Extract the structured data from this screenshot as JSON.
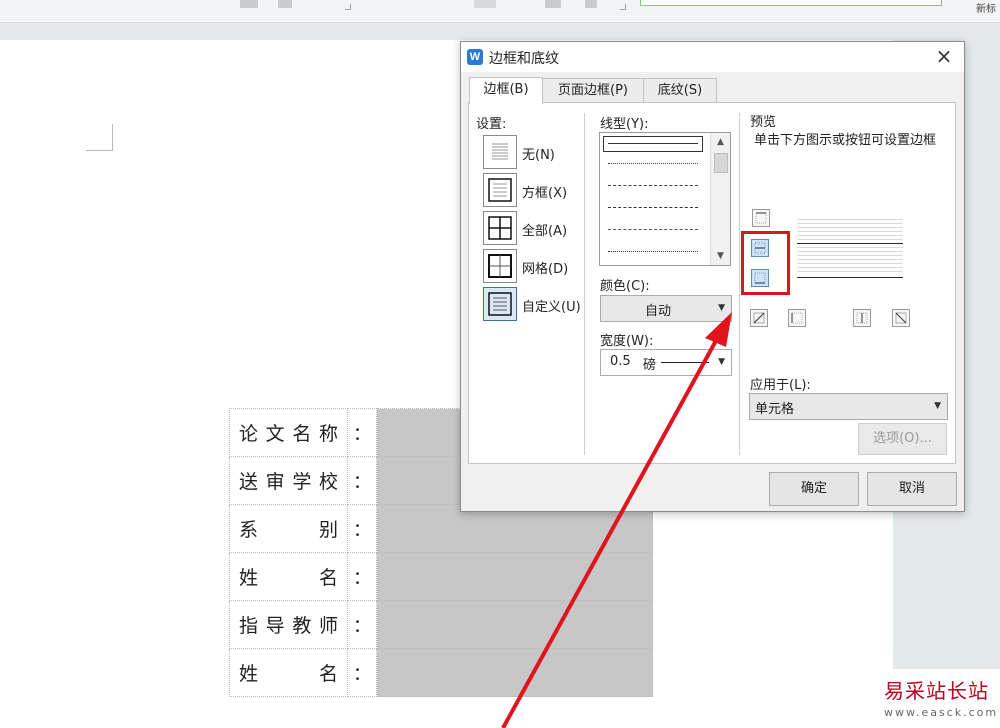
{
  "toolbar": {
    "right_text": "新标"
  },
  "document_table": {
    "rows": [
      {
        "label": [
          "论",
          "文",
          "名",
          "称"
        ],
        "colon": "："
      },
      {
        "label": [
          "送",
          "审",
          "学",
          "校"
        ],
        "colon": "："
      },
      {
        "label": [
          "系",
          "别"
        ],
        "colon": "："
      },
      {
        "label": [
          "姓",
          "名"
        ],
        "colon": "："
      },
      {
        "label": [
          "指",
          "导",
          "教",
          "师"
        ],
        "colon": "："
      },
      {
        "label": [
          "姓",
          "名"
        ],
        "colon": "："
      }
    ]
  },
  "dialog": {
    "app_icon": "W",
    "title": "边框和底纹",
    "close_icon": "×",
    "tabs": [
      {
        "label": "边框(B)",
        "active": true
      },
      {
        "label": "页面边框(P)",
        "active": false
      },
      {
        "label": "底纹(S)",
        "active": false
      }
    ],
    "setting": {
      "label": "设置:",
      "items": [
        {
          "label": "无(N)",
          "icon": "no-border-icon"
        },
        {
          "label": "方框(X)",
          "icon": "box-border-icon"
        },
        {
          "label": "全部(A)",
          "icon": "all-borders-icon"
        },
        {
          "label": "网格(D)",
          "icon": "grid-borders-icon"
        },
        {
          "label": "自定义(U)",
          "icon": "custom-border-icon",
          "selected": true
        }
      ]
    },
    "line_style": {
      "label": "线型(Y):"
    },
    "color": {
      "label": "颜色(C):",
      "value": "自动"
    },
    "width": {
      "label": "宽度(W):",
      "value": "0.5",
      "unit": "磅"
    },
    "preview": {
      "label": "预览",
      "hint": "单击下方图示或按钮可设置边框"
    },
    "apply_to": {
      "label": "应用于(L):",
      "value": "单元格"
    },
    "options_button": "选项(O)...",
    "ok_button": "确定",
    "cancel_button": "取消"
  },
  "watermark": {
    "text": "易采站长站",
    "url": "www.easck.com"
  },
  "colors": {
    "highlight": "#d8181e",
    "arrow": "#e0141e",
    "cell_fill": "#c7c7c7"
  }
}
